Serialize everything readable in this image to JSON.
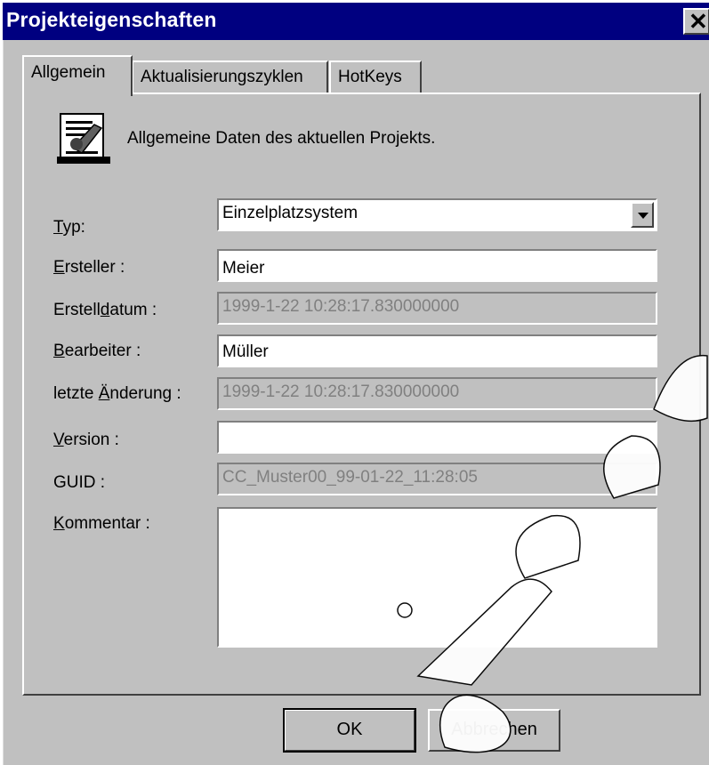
{
  "window": {
    "title": "Projekteigenschaften",
    "close_glyph": "✕"
  },
  "tabs": [
    {
      "label": "Allgemein",
      "active": true
    },
    {
      "label": "Aktualisierungszyklen",
      "active": false
    },
    {
      "label": "HotKeys",
      "active": false
    }
  ],
  "header": {
    "icon": "project-properties-icon",
    "text": "Allgemeine Daten des aktuellen Projekts."
  },
  "fields": {
    "typ": {
      "label": "Typ:",
      "value": "Einzelplatzsystem",
      "accelerator": "T"
    },
    "ersteller": {
      "label": "Ersteller :",
      "value": "Meier",
      "accelerator": "E"
    },
    "erstelldatum": {
      "label": "Erstelldatum :",
      "value": "1999-1-22 10:28:17.830000000",
      "accelerator": "d"
    },
    "bearbeiter": {
      "label": "Bearbeiter :",
      "value": "Müller",
      "accelerator": "B"
    },
    "letzte_aenderung": {
      "label": "letzte Änderung :",
      "value": "1999-1-22 10:28:17.830000000",
      "accelerator": "Ä"
    },
    "version": {
      "label": "Version :",
      "value": "",
      "accelerator": "V"
    },
    "guid": {
      "label": "GUID :",
      "value": "CC_Muster00_99-01-22_11:28:05"
    },
    "kommentar": {
      "label": "Kommentar :",
      "value": "",
      "accelerator": "K"
    }
  },
  "buttons": {
    "ok": "OK",
    "cancel": "Abbrechen"
  },
  "colors": {
    "titlebar": "#000080",
    "face": "#c0c0c0",
    "disabled_text": "#808080"
  }
}
